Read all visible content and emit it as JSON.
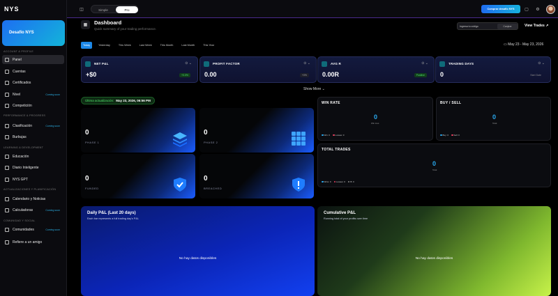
{
  "brand": {
    "logo": "NYS"
  },
  "sidebar": {
    "challenge_card": "Desafío NYS",
    "sections": [
      "Account & Profile",
      "Performance & Progress",
      "Learning & Development",
      "Actualizaciones y planificación",
      "Comunidad y social"
    ],
    "items": [
      {
        "label": "Panel",
        "tag": ""
      },
      {
        "label": "Cuentas",
        "tag": ""
      },
      {
        "label": "Certificados",
        "tag": ""
      },
      {
        "label": "Nivel",
        "tag": "Coming soon"
      },
      {
        "label": "Competición",
        "tag": ""
      },
      {
        "label": "Clasificación",
        "tag": "Coming soon"
      },
      {
        "label": "Burbujas",
        "tag": ""
      },
      {
        "label": "Educación",
        "tag": ""
      },
      {
        "label": "Diario Inteligente",
        "tag": ""
      },
      {
        "label": "NYS GPT",
        "tag": ""
      },
      {
        "label": "Calendario y Noticias",
        "tag": ""
      },
      {
        "label": "Calculadoras",
        "tag": "Coming soon"
      },
      {
        "label": "Comunidades",
        "tag": "Coming soon"
      },
      {
        "label": "Refiere a un amigo",
        "tag": ""
      }
    ]
  },
  "topbar": {
    "mode_simple": "Simple",
    "mode_pro": "Pro",
    "buy_button": "Comprar desafío NYS"
  },
  "header": {
    "title": "Dashboard",
    "subtitle": "Quick summary of your trading performance.",
    "code_placeholder": "Ingresa tu código",
    "code_button": "Canjear",
    "view_trades": "View Trades ↗",
    "date_range": "May 23 - May 23, 2026"
  },
  "periods": [
    "Today",
    "Yesterday",
    "This Week",
    "Last Week",
    "This Month",
    "Last Month",
    "This Year"
  ],
  "kpis": [
    {
      "label": "NET P&L",
      "value": "+$0",
      "badge": "+0.0%",
      "badge_color": "#4ee36a"
    },
    {
      "label": "PROFIT FACTOR",
      "value": "0.00",
      "badge": "+0%",
      "badge_color": "#aaaaaa"
    },
    {
      "label": "AVG R",
      "value": "0.00R",
      "badge": "Positive",
      "badge_color": "#4ee36a"
    },
    {
      "label": "TRADING DAYS",
      "value": "0",
      "badge": "Start Date",
      "badge_color": "#888888"
    }
  ],
  "show_more": "Show More ⌄",
  "update": {
    "label": "Última actualización:",
    "date": "May 23, 2026, 06:56 PM"
  },
  "phases": [
    {
      "value": "0",
      "label": "PHASE 1"
    },
    {
      "value": "0",
      "label": "PHASE 2"
    },
    {
      "value": "0",
      "label": "FUNDED"
    },
    {
      "value": "0",
      "label": "BREACHED"
    }
  ],
  "stats": {
    "win_rate": {
      "title": "WIN RATE",
      "value": "0",
      "sub": "Win loss",
      "legend": [
        "Win: 0",
        "Losses: 0"
      ]
    },
    "buy_sell": {
      "title": "BUY / SELL",
      "value": "0",
      "sub": "Total",
      "legend": [
        "Buy: 0",
        "Sell: 0"
      ]
    },
    "total_trades": {
      "title": "TOTAL TRADES",
      "value": "0",
      "sub": "Total",
      "legend": [
        "Wins: 0",
        "Losses: 0",
        "B: 0"
      ]
    }
  },
  "panels": {
    "daily": {
      "title": "Daily P&L (Last 20 days)",
      "subtitle": "Each bar represents a full trading day's P&L",
      "empty": "No hay datos disponibles"
    },
    "cumulative": {
      "title": "Cumulative P&L",
      "subtitle": "Running total of your profits over time",
      "empty": "No hay datos disponibles"
    }
  }
}
